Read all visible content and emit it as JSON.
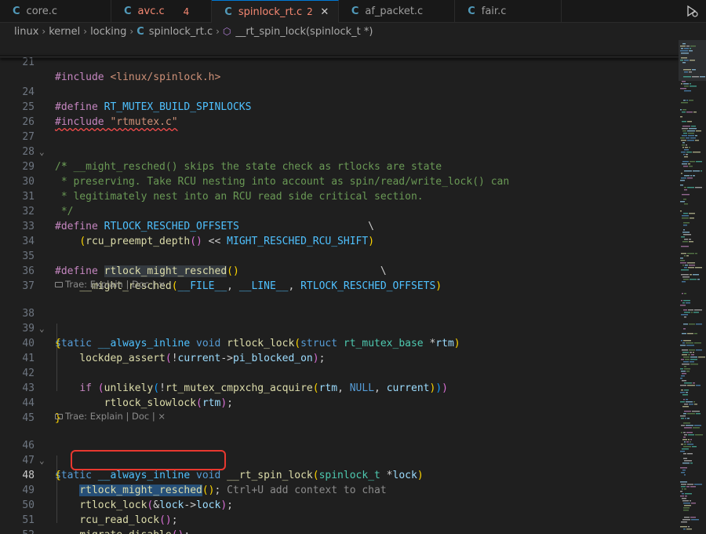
{
  "tabs": [
    {
      "icon": "C",
      "label": "core.c",
      "count": "",
      "active": false
    },
    {
      "icon": "C",
      "label": "avc.c",
      "count": "4",
      "active": false
    },
    {
      "icon": "C",
      "label": "spinlock_rt.c",
      "count": "2",
      "active": true
    },
    {
      "icon": "C",
      "label": "af_packet.c",
      "count": "",
      "active": false
    },
    {
      "icon": "C",
      "label": "fair.c",
      "count": "",
      "active": false
    }
  ],
  "breadcrumb": {
    "items": [
      "linux",
      "kernel",
      "locking"
    ],
    "file_icon": "C",
    "file": "spinlock_rt.c",
    "symbol": "__rt_spin_lock(spinlock_t *)"
  },
  "lens": {
    "trae_label": "Trae: Explain | Doc |",
    "close": "×"
  },
  "ghost_hint": "Ctrl+U add context to chat",
  "line_numbers": [
    "21",
    "24",
    "25",
    "26",
    "27",
    "28",
    "29",
    "30",
    "31",
    "32",
    "33",
    "34",
    "35",
    "36",
    "37",
    "38",
    "39",
    "40",
    "41",
    "42",
    "43",
    "44",
    "45",
    "46",
    "47",
    "48",
    "49",
    "50",
    "51",
    "52"
  ],
  "code": {
    "l21a": "#include ",
    "l21b": "<linux/spinlock.h>",
    "l24a": "#define ",
    "l24b": "RT_MUTEX_BUILD_SPINLOCKS",
    "l25a": "#include ",
    "l25b": "\"rtmutex.c\"",
    "l27": "/*",
    "l28": " * __might_resched() skips the state check as rtlocks are state",
    "l29": " * preserving. Take RCU nesting into account as spin/read/write_lock() can",
    "l30": " * legitimately nest into an RCU read side critical section.",
    "l31": " */",
    "l32a": "#define ",
    "l32b": "RTLOCK_RESCHED_OFFSETS",
    "l32c": "                     \\",
    "l33a": "    ",
    "l33b": "(",
    "l33c": "rcu_preempt_depth",
    "l33d": "()",
    "l33e": " << ",
    "l33f": "MIGHT_RESCHED_RCU_SHIFT",
    "l33g": ")",
    "l35a": "#define ",
    "l35b": "rtlock_might_resched",
    "l35c": "()",
    "l35d": "                       \\",
    "l36a": "    ",
    "l36b": "__might_resched",
    "l36c": "(",
    "l36d": "__FILE__",
    "l36e": ", ",
    "l36f": "__LINE__",
    "l36g": ", ",
    "l36h": "RTLOCK_RESCHED_OFFSETS",
    "l36i": ")",
    "l38a": "static ",
    "l38b": "__always_inline ",
    "l38c": "void ",
    "l38d": "rtlock_lock",
    "l38e": "(",
    "l38f": "struct ",
    "l38g": "rt_mutex_base ",
    "l38h": "*",
    "l38i": "rtm",
    "l38j": ")",
    "l39": "{",
    "l40a": "    ",
    "l40b": "lockdep_assert",
    "l40c": "(",
    "l40d": "!",
    "l40e": "current",
    "l40f": "->",
    "l40g": "pi_blocked_on",
    "l40h": ")",
    "l40i": ";",
    "l42a": "    ",
    "l42b": "if ",
    "l42c": "(",
    "l42d": "unlikely",
    "l42e": "(",
    "l42f": "!",
    "l42g": "rt_mutex_cmpxchg_acquire",
    "l42h": "(",
    "l42i": "rtm",
    "l42j": ", ",
    "l42k": "NULL",
    "l42l": ", ",
    "l42m": "current",
    "l42n": ")",
    "l42o": ")",
    "l42p": ")",
    "l43a": "        ",
    "l43b": "rtlock_slowlock",
    "l43c": "(",
    "l43d": "rtm",
    "l43e": ")",
    "l43f": ";",
    "l44": "}",
    "l46a": "static ",
    "l46b": "__always_inline ",
    "l46c": "void ",
    "l46d": "__rt_spin_lock",
    "l46e": "(",
    "l46f": "spinlock_t ",
    "l46g": "*",
    "l46h": "lock",
    "l46i": ")",
    "l47": "{",
    "l48a": "    ",
    "l48b": "rtlock_might_resched",
    "l48c": "()",
    "l48d": ";",
    "l49a": "    ",
    "l49b": "rtlock_lock",
    "l49c": "(",
    "l49d": "&",
    "l49e": "lock",
    "l49f": "->",
    "l49g": "lock",
    "l49h": ")",
    "l49i": ";",
    "l50a": "    ",
    "l50b": "rcu_read_lock",
    "l50c": "()",
    "l50d": ";",
    "l51a": "    ",
    "l51b": "migrate_disable",
    "l51c": "()",
    "l51d": ";",
    "l52": "}"
  },
  "colors": {
    "accent": "#0078d4",
    "error": "#f48771",
    "highlight_box": "#e8382f"
  }
}
